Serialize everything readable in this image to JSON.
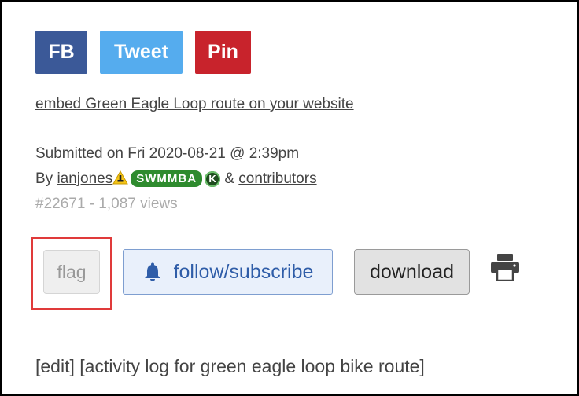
{
  "share": {
    "fb_label": "FB",
    "tweet_label": "Tweet",
    "pin_label": "Pin"
  },
  "embed_link": "embed Green Eagle Loop route on your website",
  "meta": {
    "submitted": "Submitted on Fri 2020-08-21 @ 2:39pm",
    "by_prefix": "By ",
    "author": "ianjones",
    "author_badge": "SWMMBA",
    "k_badge": "K",
    "amp": " & ",
    "contributors": "contributors",
    "stats": "#22671 - 1,087 views"
  },
  "actions": {
    "flag_label": "flag",
    "follow_label": "follow/subscribe",
    "download_label": "download"
  },
  "bottom": {
    "edit_label": "[edit]",
    "activity_label": "[activity log for green eagle loop bike route]"
  },
  "colors": {
    "fb": "#3b5998",
    "twitter": "#55acee",
    "pinterest": "#c8232c",
    "badge_green": "#2e8b2e",
    "highlight": "#e03a3a",
    "follow_text": "#2f5da8"
  },
  "icons": [
    "warning-icon",
    "k-badge-icon",
    "bell-icon",
    "printer-icon"
  ]
}
